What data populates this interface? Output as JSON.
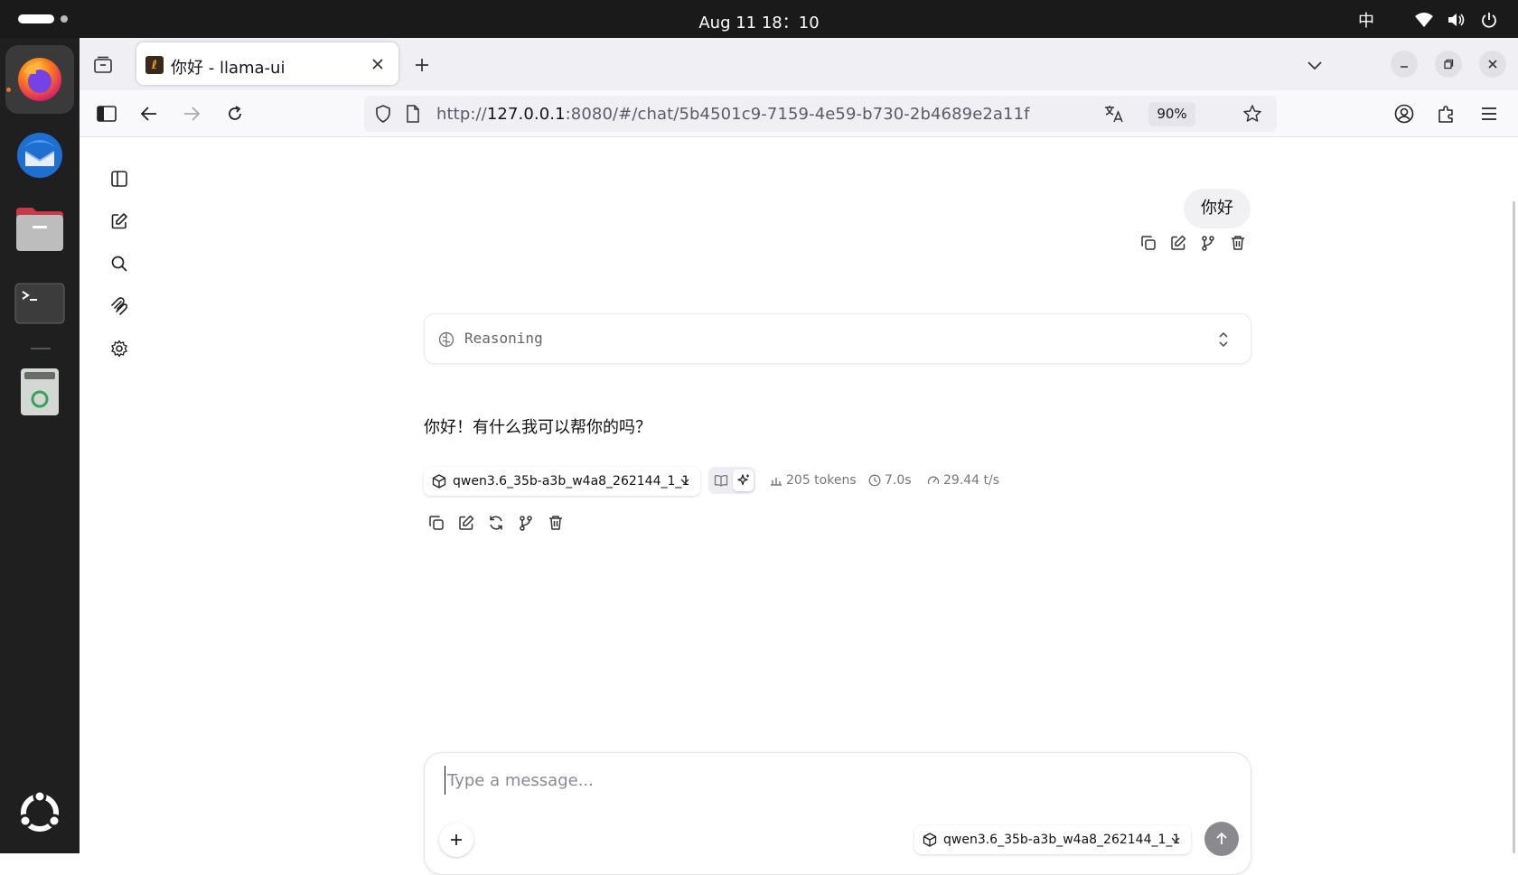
{
  "system_bar": {
    "clock": "Aug 11  18：10",
    "input_method": "中"
  },
  "dock": {
    "items": [
      {
        "name": "firefox",
        "active": true
      },
      {
        "name": "thunderbird"
      },
      {
        "name": "files"
      },
      {
        "name": "terminal"
      },
      {
        "name": "trash"
      }
    ]
  },
  "browser": {
    "tab_title": "你好 - llama-ui",
    "url_scheme": "http://",
    "url_host": "127.0.0.1",
    "url_rest": ":8080/#/chat/5b4501c9-7159-4e59-b730-2b4689e2a11f",
    "zoom": "90%"
  },
  "chat": {
    "user_message": "你好",
    "reasoning_label": "Reasoning",
    "assistant_message": "你好！有什么我可以帮你的吗？",
    "model_name": "qwen3.6_35b-a3b_w4a8_262144_1_1",
    "stats": {
      "tokens": "205 tokens",
      "time": "7.0s",
      "speed": "29.44 t/s"
    }
  },
  "composer": {
    "placeholder": "Type a message...",
    "model_name": "qwen3.6_35b-a3b_w4a8_262144_1_1"
  },
  "colors": {
    "system_bar": "#1a1a1a",
    "dock": "#1f1f1f",
    "send_button": "#8a8a8e"
  }
}
